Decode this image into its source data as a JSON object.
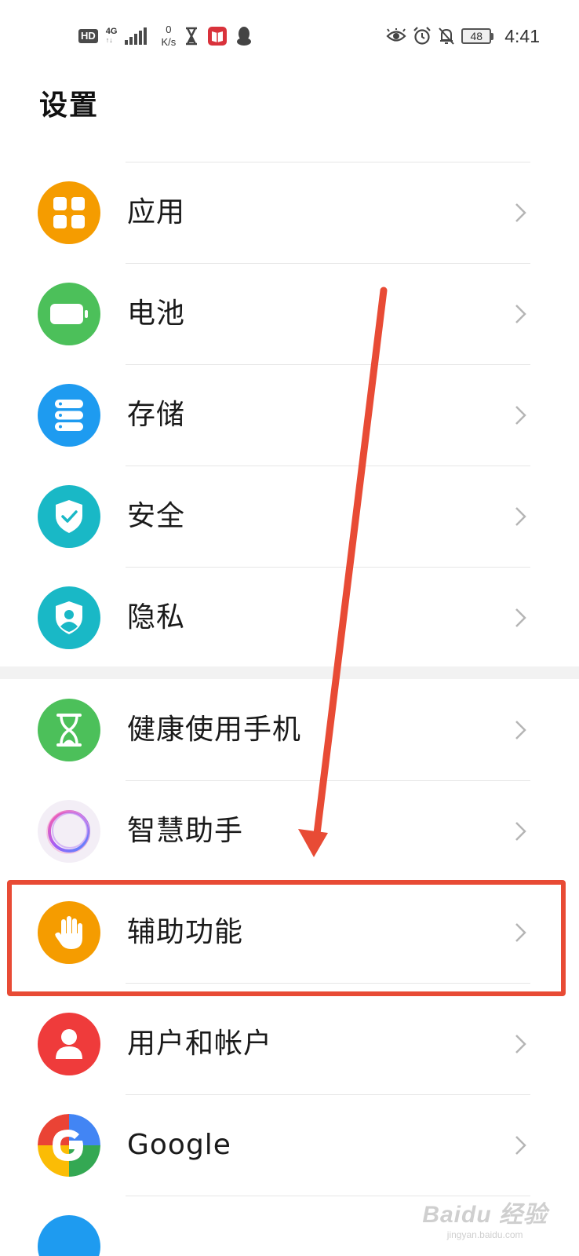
{
  "status_bar": {
    "hd": "HD",
    "network": "4G",
    "network_arrows": "↑↓",
    "speed_value": "0",
    "speed_unit": "K/s",
    "battery_level": "48",
    "time": "4:41"
  },
  "page": {
    "title": "设置"
  },
  "settings_group_1": [
    {
      "label": "应用",
      "icon": "apps-grid-icon",
      "color": "#f59c00"
    },
    {
      "label": "电池",
      "icon": "battery-icon",
      "color": "#4cc05a"
    },
    {
      "label": "存储",
      "icon": "storage-icon",
      "color": "#1e9bf0"
    },
    {
      "label": "安全",
      "icon": "shield-check-icon",
      "color": "#19b8c6"
    },
    {
      "label": "隐私",
      "icon": "privacy-shield-icon",
      "color": "#19b8c6"
    }
  ],
  "settings_group_2": [
    {
      "label": "健康使用手机",
      "icon": "hourglass-icon",
      "color": "#4cc05a"
    },
    {
      "label": "智慧助手",
      "icon": "smart-assistant-icon",
      "color": "#f3eef6"
    },
    {
      "label": "辅助功能",
      "icon": "hand-icon",
      "color": "#f59c00"
    },
    {
      "label": "用户和帐户",
      "icon": "user-icon",
      "color": "#ef3b3b"
    },
    {
      "label": "Google",
      "icon": "google-icon",
      "color": "#4285f4"
    }
  ],
  "annotation": {
    "highlight_color": "#e84b35"
  },
  "watermark": {
    "top": "Baidu 经验",
    "bottom": "jingyan.baidu.com"
  }
}
